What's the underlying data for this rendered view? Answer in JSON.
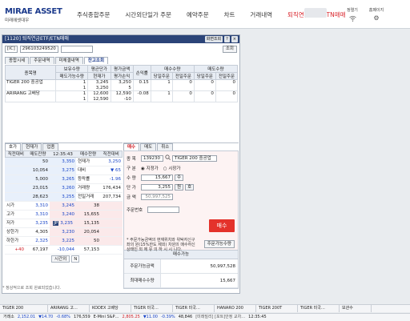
{
  "header": {
    "logo": "MIRAE ASSET",
    "logo_sub": "미래에셋대우",
    "menu": [
      "주식종합주문",
      "시간외단일가 주문",
      "예약주문",
      "차트",
      "거래내역",
      "퇴직연금ETF/ETN매매"
    ],
    "right_items": [
      {
        "label": "정렬기",
        "icon": "wifi-icon"
      },
      {
        "label": "홈페이지",
        "icon": "gear-icon"
      }
    ]
  },
  "window": {
    "title": "[1120] 퇴직연금ETF/ETN매매",
    "buttons": [
      "화면조회",
      "?",
      "×"
    ],
    "account_type": "[IC]",
    "account_number": "296103249520",
    "lookup_button": "조회",
    "tabs": [
      "종합시세",
      "주문내역",
      "미체결내역",
      "잔고조회"
    ],
    "active_tab": 3,
    "holdings": {
      "headers_top": [
        "종목명",
        "보유수량",
        "평균단가",
        "평가금액",
        "손익률",
        "매수수량",
        "매도수량"
      ],
      "headers_sub": [
        "매도가능수량",
        "현재가",
        "평가손익",
        "당일주문",
        "전일주문",
        "당일주문",
        "전일주문"
      ],
      "rows": [
        {
          "name": "TIGER 200 중공업",
          "qty": "1",
          "sellable": "1",
          "avg_price": "3,245",
          "cur_price": "3,250",
          "eval_amount": "3,250",
          "eval_pl": "5",
          "return": "0.15",
          "buy_today": "1",
          "buy_prev": "0",
          "sell_today": "0",
          "sell_prev": "0"
        },
        {
          "name": "ARIRANG 고배당",
          "qty": "1",
          "sellable": "1",
          "avg_price": "12,600",
          "cur_price": "12,590",
          "eval_amount": "12,590",
          "eval_pl": "-10",
          "return": "-0.08",
          "buy_today": "1",
          "buy_prev": "0",
          "sell_today": "0",
          "sell_prev": "0"
        }
      ]
    }
  },
  "quote": {
    "tabs": [
      "호가",
      "현재가",
      "업종"
    ],
    "headers": [
      "직전대비",
      "매도잔량",
      "12:35:43",
      "매수잔량",
      "직전대비"
    ],
    "asks": [
      {
        "chg": "",
        "qty": "50",
        "price": "3,350",
        "label": "현재가",
        "value": "3,250"
      },
      {
        "chg": "",
        "qty": "10,054",
        "price": "3,275",
        "label": "대비",
        "value": "▼ 65"
      },
      {
        "chg": "",
        "qty": "5,000",
        "price": "3,265",
        "label": "등락률",
        "value": "-1.96"
      },
      {
        "chg": "",
        "qty": "23,015",
        "price": "3,260",
        "label": "거래량",
        "value": "176,434"
      },
      {
        "chg": "",
        "qty": "28,623",
        "price": "3,255",
        "label": "전일거래",
        "value": "207,734"
      }
    ],
    "bids": [
      {
        "label": "시가",
        "val": "3,310",
        "price": "3,245",
        "qty": "38"
      },
      {
        "label": "고가",
        "val": "3,310",
        "price": "3,240",
        "qty": "15,655"
      },
      {
        "label": "저가",
        "val": "3,235",
        "price": "3,235",
        "qty": "15,135"
      },
      {
        "label": "상한가",
        "val": "4,305",
        "price": "3,230",
        "qty": "20,054"
      },
      {
        "label": "하한가",
        "val": "2,325",
        "price": "3,225",
        "qty": "50"
      }
    ],
    "totals": {
      "chg": "+40",
      "ask_total": "67,197",
      "diff": "-10,044",
      "bid_total": "57,153"
    },
    "after_hours_btn": "시간외",
    "jp_label": "JP",
    "n_label": "N"
  },
  "order": {
    "tabs": [
      "매수",
      "매도",
      "취소"
    ],
    "code_label": "종 목",
    "code": "139230",
    "code_name": "TIGER 200 중공업",
    "type_label": "구 분",
    "type_opt1": "지정가",
    "type_opt2": "시장가",
    "qty_label": "수 량",
    "qty_value": "15,667",
    "qty_unit": "주",
    "price_label": "단 가",
    "price_value": "3,255",
    "price_unit": "원",
    "price_btn": "호",
    "amount_label": "금 액",
    "amount_value": "50,997,525",
    "pin_label": "주문번호",
    "buy_button": "매수",
    "note": "* 주문가능금액의 현재위치와 위탁자신구좌의 원(15%한도 제외) 차원의 매수하신 상태인 외 에 유 의 하 시 시 니다.",
    "ord_cap_btn": "주문가능수량",
    "avail_header": "매수가능",
    "avail_rows": [
      {
        "label": "주문가능금액",
        "value": "50,997,528"
      },
      {
        "label": "최대매수수량",
        "value": "15,667"
      }
    ]
  },
  "status_text": "* 정상적으로 조회 완료되었습니다.",
  "ticker_tabs": [
    "TIGER 200",
    "ARIRANG 고…",
    "KODEX 고배당",
    "TIGER 미국…",
    "TIGER 미국…",
    "HANARO 200",
    "TIGER 200T",
    "TIGER 미국…",
    "보관수"
  ],
  "index_bar": [
    {
      "text": "거래소",
      "color": "#222"
    },
    {
      "text": "2,152.01",
      "color": "#1a46c8"
    },
    {
      "text": "▼14.70",
      "color": "#1a46c8"
    },
    {
      "text": "-0.68%",
      "color": "#1a46c8"
    },
    {
      "text": "176,559",
      "color": "#222"
    },
    {
      "text": "E-Mini S&P…",
      "color": "#222"
    },
    {
      "text": "2,805.25",
      "color": "#d11f26"
    },
    {
      "text": "▼11.00",
      "color": "#1a46c8"
    },
    {
      "text": "-0.39%",
      "color": "#1a46c8"
    },
    {
      "text": "48,846",
      "color": "#222"
    },
    {
      "text": "[미래밀리] [포트]안정 교차…",
      "color": "#555"
    },
    {
      "text": "12:35:45",
      "color": "#222"
    }
  ]
}
